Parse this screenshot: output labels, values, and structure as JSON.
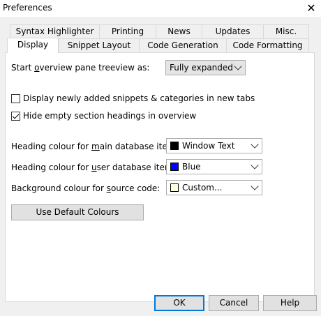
{
  "window": {
    "title": "Preferences",
    "close_glyph": "✕"
  },
  "tabs_row1": [
    "Syntax Highlighter",
    "Printing",
    "News",
    "Updates",
    "Misc."
  ],
  "tabs_row2": [
    "Display",
    "Snippet Layout",
    "Code Generation",
    "Code Formatting"
  ],
  "display": {
    "overview_label_pre": "Start ",
    "overview_label_u": "o",
    "overview_label_post": "verview pane treeview as:",
    "overview_value": "Fully expanded",
    "checkbox1_label": "Display newly added snippets & categories in new tabs",
    "checkbox1_checked": false,
    "checkbox2_label": "Hide empty section headings in overview",
    "checkbox2_checked": true,
    "main_label_pre": "Heading colour for ",
    "main_label_u": "m",
    "main_label_post": "ain database items:",
    "main_value": "Window Text",
    "main_color": "#000000",
    "user_label_pre": "Heading colour for ",
    "user_label_u": "u",
    "user_label_post": "ser database items:",
    "user_value": "Blue",
    "user_color": "#0000ff",
    "bg_label_pre": "Background colour for ",
    "bg_label_u": "s",
    "bg_label_post": "ource code:",
    "bg_value": "Custom...",
    "bg_color": "#ffffe0",
    "default_colours_button": "Use Default Colours"
  },
  "buttons": {
    "ok": "OK",
    "cancel": "Cancel",
    "help": "Help"
  }
}
